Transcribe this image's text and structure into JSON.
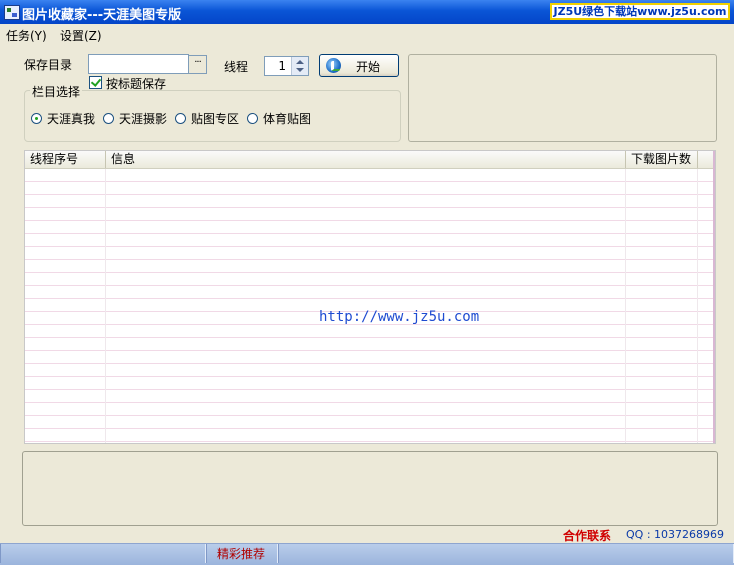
{
  "window": {
    "title": "图片收藏家---天涯美图专版",
    "watermark": "JZ5U绿色下载站www.jz5u.com"
  },
  "menu": {
    "items": [
      {
        "label": "任务(Y)"
      },
      {
        "label": "设置(Z)"
      }
    ]
  },
  "form": {
    "save_dir_label": "保存目录",
    "save_dir_value": "",
    "browse_label": "···",
    "save_by_title_label": "按标题保存",
    "save_by_title_checked": true,
    "thread_label": "线程",
    "thread_value": "1",
    "start_label": "开始"
  },
  "column_group": {
    "legend": "栏目选择",
    "options": [
      {
        "label": "天涯真我",
        "selected": true
      },
      {
        "label": "天涯摄影",
        "selected": false
      },
      {
        "label": "贴图专区",
        "selected": false
      },
      {
        "label": "体育贴图",
        "selected": false
      }
    ]
  },
  "table": {
    "columns": [
      "线程序号",
      "信息",
      "下载图片数"
    ],
    "rows": []
  },
  "center_url": "http://www.jz5u.com",
  "footer": {
    "contact_label": "合作联系",
    "qq_text": "QQ : 1037268969",
    "recommend_label": "精彩推荐"
  },
  "colors": {
    "titlebar": "#0a55d6",
    "window_bg": "#ece9d8",
    "accent_red": "#d00000",
    "link_blue": "#1f4bd1"
  }
}
